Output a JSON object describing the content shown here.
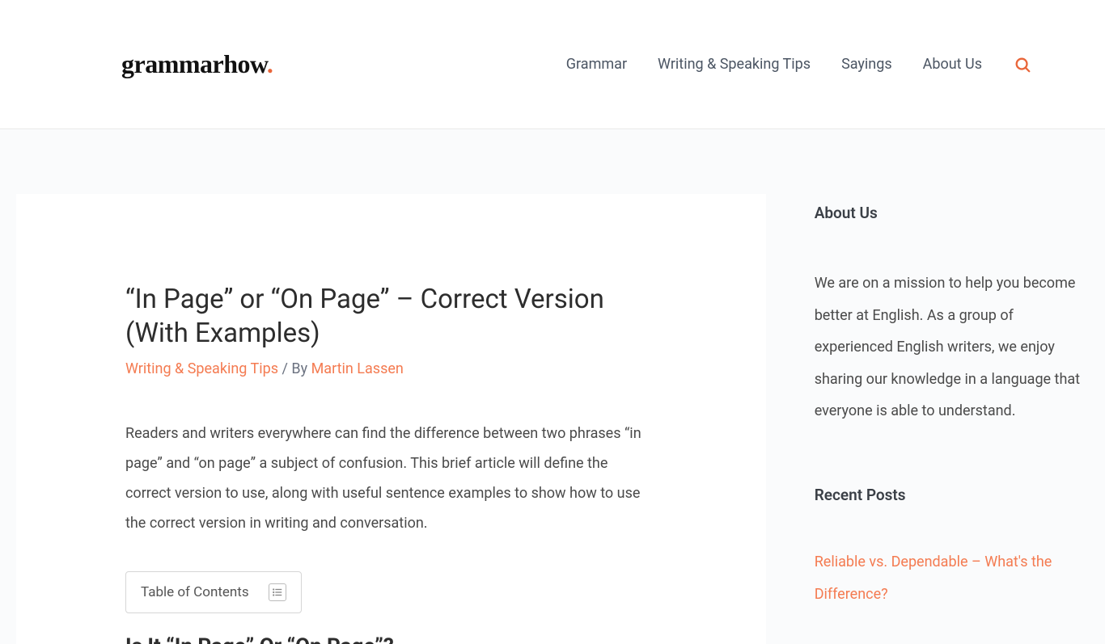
{
  "logo": {
    "text": "grammarhow",
    "dot": "."
  },
  "nav": {
    "items": [
      "Grammar",
      "Writing & Speaking Tips",
      "Sayings",
      "About Us"
    ]
  },
  "article": {
    "title": "“In Page” or “On Page” – Correct Version (With Examples)",
    "category": "Writing & Speaking Tips",
    "byline_sep": " / By ",
    "author": "Martin Lassen",
    "intro": "Readers and writers everywhere can find the difference between two phrases “in page” and “on page” a subject of confusion. This brief article will define the correct version to use, along with useful sentence examples to show how to use the correct version in writing and conversation.",
    "toc_label": "Table of Contents",
    "next_heading": "Is It “In Page” Or “On Page”?"
  },
  "sidebar": {
    "about_heading": "About Us",
    "about_text": "We are on a mission to help you become better at English. As a group of experienced English writers, we enjoy sharing our knowledge in a language that everyone is able to understand.",
    "recent_heading": "Recent Posts",
    "recent_link": "Reliable vs. Dependable – What's the Difference?"
  }
}
